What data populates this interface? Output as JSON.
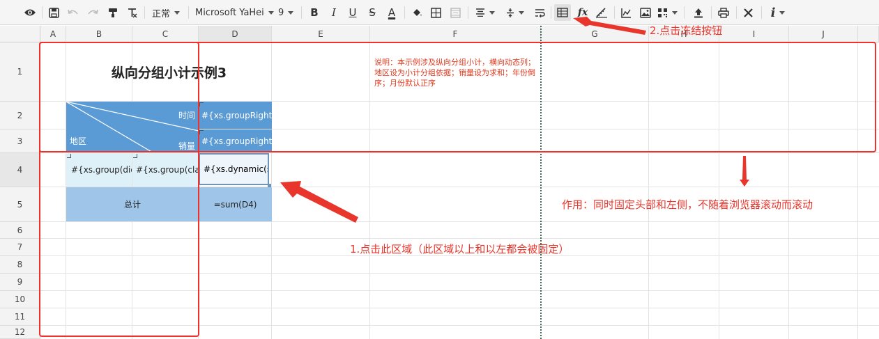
{
  "toolbar": {
    "style_select": "正常",
    "font_select": "Microsoft YaHei",
    "size_select": "9",
    "fx_label": "fx",
    "info_label": "i",
    "bold_label": "B",
    "italic_label": "I",
    "underline_label": "U",
    "strike_label": "S",
    "fontcolor_label": "A"
  },
  "columns": [
    "A",
    "B",
    "C",
    "D",
    "E",
    "F",
    "G",
    "H",
    "I",
    "J"
  ],
  "rows": [
    "1",
    "2",
    "3",
    "4",
    "5",
    "6",
    "7",
    "8",
    "9",
    "10",
    "11",
    "12"
  ],
  "cells": {
    "title": "纵向分组小计示例3",
    "time_label": "时间",
    "region_label": "地区",
    "sales_label": "销量",
    "d2": "#{xs.groupRight",
    "d3": "#{xs.groupRight",
    "b4": "#{xs.group(diq",
    "c4": "#{xs.group(clas",
    "d4": "#{xs.dynamic(sal",
    "total": "总计",
    "d5": "=sum(D4)",
    "note": "说明：本示例涉及纵向分组小计，横向动态列；地区设为小计分组依据；销量设为求和；年份倒序；月份默认正序"
  },
  "annotations": {
    "step1": "1.点击此区域（此区域以上和以左都会被固定）",
    "step2": "2.点击冻结按钮",
    "effect": "作用：同时固定头部和左侧，不随着浏览器滚动而滚动"
  },
  "colors": {
    "header_blue": "#5b9bd5",
    "light_cyan": "#dff1f8",
    "mid_blue": "#9fc5e8",
    "annotation_red": "#e8362c"
  }
}
